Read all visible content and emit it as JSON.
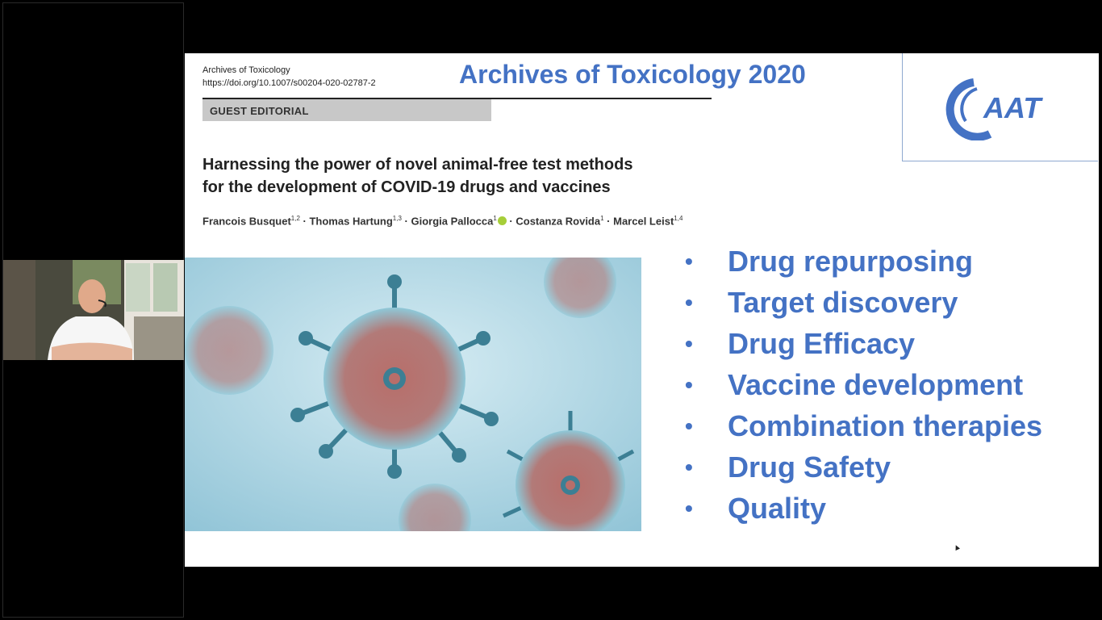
{
  "participant": {
    "video_label": ""
  },
  "slide": {
    "journal_name": "Archives of Toxicology",
    "doi": "https://doi.org/10.1007/s00204-020-02787-2",
    "section_label": "GUEST EDITORIAL",
    "heading": "Archives of Toxicology 2020",
    "logo_text": "AAT",
    "paper_title_line1": "Harnessing the power of novel animal-free test methods",
    "paper_title_line2": "for the development of COVID-19 drugs and vaccines",
    "authors": [
      {
        "name": "Francois Busquet",
        "sup": "1,2",
        "sep": " · "
      },
      {
        "name": "Thomas Hartung",
        "sup": "1,3",
        "sep": " · "
      },
      {
        "name": "Giorgia Pallocca",
        "sup": "1",
        "sep": " · "
      },
      {
        "name": "Costanza Rovida",
        "sup": "1",
        "sep": " · "
      },
      {
        "name": "Marcel Leist",
        "sup": "1,4",
        "sep": ""
      }
    ],
    "bullet_glyph": "•",
    "bullets": [
      "Drug repurposing",
      "Target discovery",
      "Drug Efficacy",
      "Vaccine development",
      "Combination therapies",
      "Drug Safety",
      "Quality"
    ],
    "colors": {
      "accent": "#4472c4",
      "bar": "#c8c8c8",
      "virus_bg": "#a9d3e2"
    }
  }
}
